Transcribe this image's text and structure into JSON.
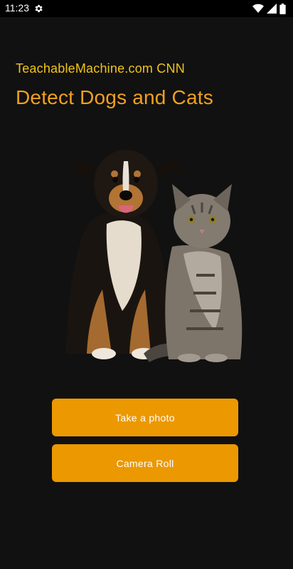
{
  "status_bar": {
    "time": "11:23",
    "icons": [
      "gear-icon",
      "wifi-icon",
      "signal-icon",
      "battery-icon"
    ]
  },
  "app": {
    "subtitle": "TeachableMachine.com CNN",
    "title": "Detect Dogs and Cats",
    "hero_image": "dog-and-cat-image",
    "buttons": {
      "take_photo": "Take a photo",
      "camera_roll": "Camera Roll"
    }
  },
  "colors": {
    "background": "#111111",
    "subtitle": "#f0c419",
    "title": "#f0a020",
    "button": "#ec9800"
  }
}
